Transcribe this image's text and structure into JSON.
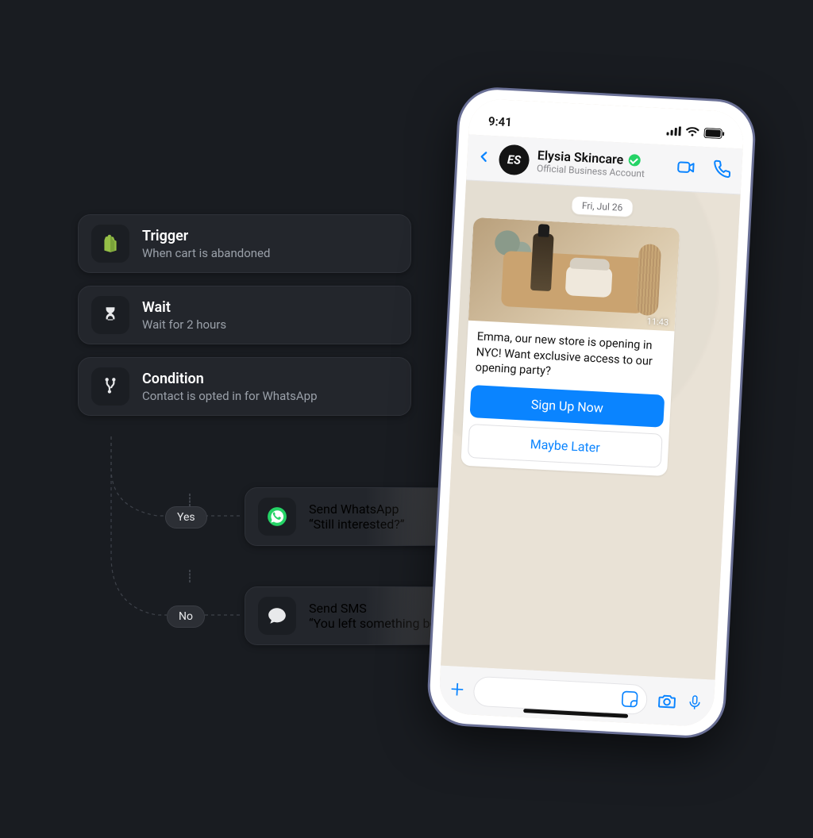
{
  "flow": {
    "trigger": {
      "title": "Trigger",
      "sub": "When cart is abandoned",
      "icon": "shopify-icon"
    },
    "wait": {
      "title": "Wait",
      "sub": "Wait for 2 hours",
      "icon": "hourglass-icon"
    },
    "condition": {
      "title": "Condition",
      "sub": "Contact is opted in for WhatsApp",
      "icon": "branch-icon"
    },
    "branches": {
      "yes": {
        "pill": "Yes",
        "title": "Send WhatsApp",
        "sub": "“Still interested?”",
        "icon": "whatsapp-icon"
      },
      "no": {
        "pill": "No",
        "title": "Send SMS",
        "sub": "“You left something behind.”",
        "icon": "sms-icon"
      }
    }
  },
  "phone": {
    "status": {
      "time": "9:41"
    },
    "header": {
      "name": "Elysia Skincare",
      "subtitle": "Official Business Account",
      "avatar_initials": "ES"
    },
    "chat": {
      "date": "Fri, Jul 26",
      "image_time": "11:43",
      "message": "Emma, our new store is opening in NYC! Want exclusive access to our opening party?",
      "primary_button": "Sign Up Now",
      "secondary_button": "Maybe Later"
    }
  },
  "colors": {
    "shopify": "#95BF47",
    "whatsapp": "#25D366",
    "ios_blue": "#0A84FF"
  }
}
